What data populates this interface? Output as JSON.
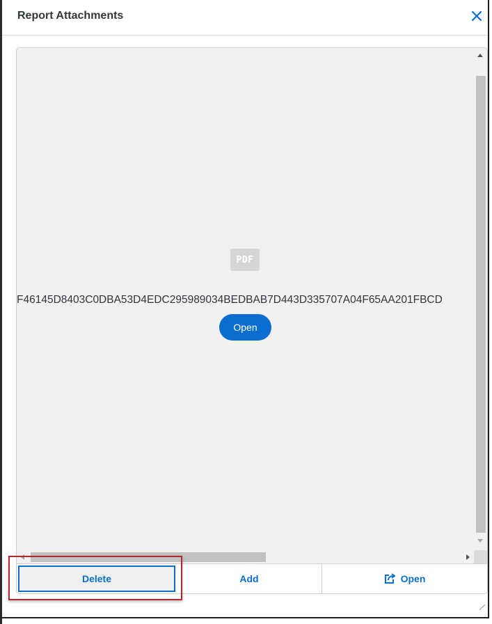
{
  "dialog": {
    "title": "Report Attachments",
    "close_icon": "close-icon"
  },
  "viewer": {
    "file_type_icon": "pdf-icon",
    "file_type_label": "PDF",
    "filename": "F46145D8403C0DBA53D4EDC295989034BEDBAB7D443D335707A04F65AA201FBCD",
    "open_label": "Open"
  },
  "toolbar": {
    "delete_label": "Delete",
    "add_label": "Add",
    "open_label": "Open",
    "open_icon": "external-link-icon"
  },
  "colors": {
    "accent": "#0a6ed1",
    "highlight_border": "#b22a2a",
    "viewer_bg": "#f1f1f1"
  }
}
